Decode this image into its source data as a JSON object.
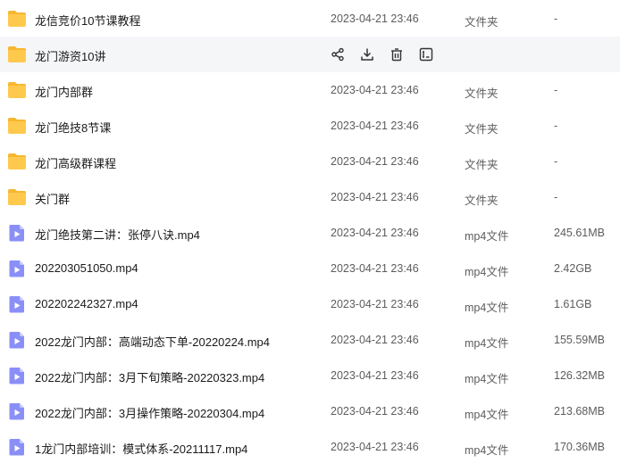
{
  "files": [
    {
      "name": "龙信竞价10节课教程",
      "date": "2023-04-21 23:46",
      "type": "文件夹",
      "size": "-",
      "kind": "folder"
    },
    {
      "name": "龙门游资10讲",
      "date": "",
      "type": "",
      "size": "",
      "kind": "folder",
      "hovered": true
    },
    {
      "name": "龙门内部群",
      "date": "2023-04-21 23:46",
      "type": "文件夹",
      "size": "-",
      "kind": "folder"
    },
    {
      "name": "龙门绝技8节课",
      "date": "2023-04-21 23:46",
      "type": "文件夹",
      "size": "-",
      "kind": "folder"
    },
    {
      "name": "龙门高级群课程",
      "date": "2023-04-21 23:46",
      "type": "文件夹",
      "size": "-",
      "kind": "folder"
    },
    {
      "name": "关门群",
      "date": "2023-04-21 23:46",
      "type": "文件夹",
      "size": "-",
      "kind": "folder"
    },
    {
      "name": "龙门绝技第二讲：张停八诀.mp4",
      "date": "2023-04-21 23:46",
      "type": "mp4文件",
      "size": "245.61MB",
      "kind": "video"
    },
    {
      "name": "202203051050.mp4",
      "date": "2023-04-21 23:46",
      "type": "mp4文件",
      "size": "2.42GB",
      "kind": "video"
    },
    {
      "name": "202202242327.mp4",
      "date": "2023-04-21 23:46",
      "type": "mp4文件",
      "size": "1.61GB",
      "kind": "video"
    },
    {
      "name": "2022龙门内部：高端动态下单-20220224.mp4",
      "date": "2023-04-21 23:46",
      "type": "mp4文件",
      "size": "155.59MB",
      "kind": "video"
    },
    {
      "name": "2022龙门内部：3月下旬策略-20220323.mp4",
      "date": "2023-04-21 23:46",
      "type": "mp4文件",
      "size": "126.32MB",
      "kind": "video"
    },
    {
      "name": "2022龙门内部：3月操作策略-20220304.mp4",
      "date": "2023-04-21 23:46",
      "type": "mp4文件",
      "size": "213.68MB",
      "kind": "video"
    },
    {
      "name": "1龙门内部培训：模式体系-20211117.mp4",
      "date": "2023-04-21 23:46",
      "type": "mp4文件",
      "size": "170.36MB",
      "kind": "video"
    }
  ],
  "hover_actions": [
    "share-icon",
    "download-icon",
    "delete-icon",
    "rename-icon"
  ],
  "colors": {
    "folder": "#ffc94d",
    "folder_tab": "#f7b731",
    "video": "#8a8ff8",
    "hover_bg": "#f5f6f8",
    "text": "#1a1a1a",
    "meta_text": "#5c5c5c",
    "action_icon": "#333333"
  }
}
